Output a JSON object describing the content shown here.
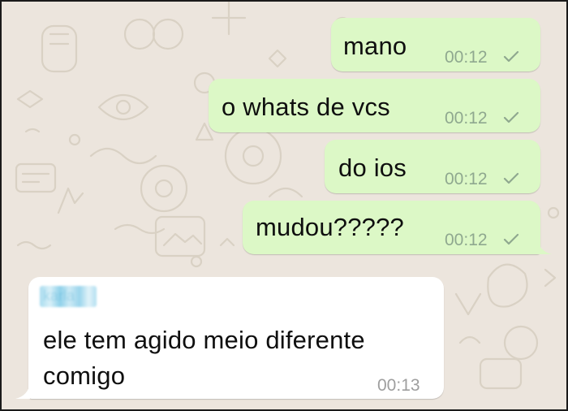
{
  "chat": {
    "outgoing": [
      {
        "text": "mano",
        "time": "00:12",
        "status": "sent-check-icon"
      },
      {
        "text": "o whats de vcs",
        "time": "00:12",
        "status": "sent-check-icon"
      },
      {
        "text": "do ios",
        "time": "00:12",
        "status": "sent-check-icon"
      },
      {
        "text": "mudou?????",
        "time": "00:12",
        "status": "sent-check-icon"
      }
    ],
    "incoming": [
      {
        "sender": "karla",
        "line1": "ele tem agido meio diferente",
        "line2": "comigo",
        "time": "00:13"
      }
    ]
  },
  "colors": {
    "background": "#ece5dd",
    "outgoing_bubble": "#dcf8c6",
    "incoming_bubble": "#ffffff",
    "blurred_sender_name": "#8fd1ea"
  }
}
